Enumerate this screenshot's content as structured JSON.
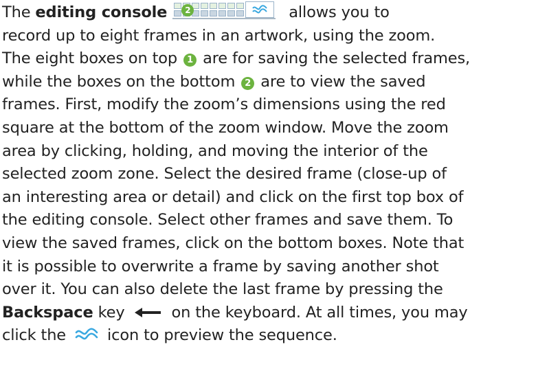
{
  "paragraph": {
    "l1_a": "The ",
    "l1_bold": "editing console",
    "l1_b": " allows you to",
    "l2": "record up to eight frames in an artwork, using the zoom.",
    "l3_a": "The eight boxes on top ",
    "badge1": "1",
    "l3_b": " are for saving the selected frames,",
    "l4_a": "while the boxes on the bottom ",
    "badge2": "2",
    "l4_b": " are to view the saved",
    "l5": "frames. First, modify the zoom’s dimensions using the red",
    "l6": "square at the bottom of the zoom window. Move the zoom",
    "l7": "area by clicking, holding, and moving the interior of the",
    "l8": "selected zoom zone. Select the desired frame (close-up of",
    "l9": "an interesting area or detail) and click on the first top box of",
    "l10": "the editing console. Select other frames and save them. To",
    "l11": "view the saved frames, click on the bottom boxes. Note that",
    "l12": "it is possible to overwrite a frame by saving another shot",
    "l13": "over it. You can also delete the last frame by pressing the",
    "l14_bold": "Backspace",
    "l14_a": " key ",
    "l14_b": " on the keyboard. At all times, you may",
    "l15_a": "click the ",
    "l15_b": " icon to preview the sequence."
  },
  "console_badge": "2",
  "icons": {
    "console": "editing-console-image",
    "arrow": "left-arrow-icon",
    "wave": "wave-icon"
  },
  "colors": {
    "badge": "#6cb33f",
    "wave": "#3aa8e0",
    "text": "#222222"
  }
}
